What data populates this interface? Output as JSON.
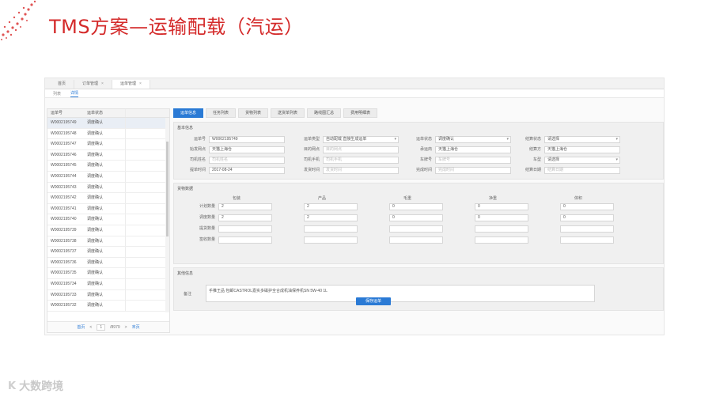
{
  "slide": {
    "title": "TMS方案—运输配载（汽运）",
    "brand_text": "大数跨境",
    "brand_logo": "K"
  },
  "colors": {
    "accent": "#2a7ad5",
    "title_red": "#d42a2a"
  },
  "topnav": {
    "tabs": [
      {
        "label": "首页",
        "closable": false
      },
      {
        "label": "订单管理",
        "closable": true
      },
      {
        "label": "运单管理",
        "closable": true
      }
    ],
    "close_glyph": "×"
  },
  "subtabs": {
    "list": "列表",
    "detail": "详情"
  },
  "left_table": {
    "headers": [
      "运单号",
      "运单状态"
    ],
    "rows": [
      {
        "id": "W0002195749",
        "status": "调度确认"
      },
      {
        "id": "W0002195748",
        "status": "调度确认"
      },
      {
        "id": "W0002195747",
        "status": "调度确认"
      },
      {
        "id": "W0002195746",
        "status": "调度确认"
      },
      {
        "id": "W0002195745",
        "status": "调度确认"
      },
      {
        "id": "W0002195744",
        "status": "调度确认"
      },
      {
        "id": "W0002195743",
        "status": "调度确认"
      },
      {
        "id": "W0002195742",
        "status": "调度确认"
      },
      {
        "id": "W0002195741",
        "status": "调度确认"
      },
      {
        "id": "W0002195740",
        "status": "调度确认"
      },
      {
        "id": "W0002195739",
        "status": "调度确认"
      },
      {
        "id": "W0002195738",
        "status": "调度确认"
      },
      {
        "id": "W0002195737",
        "status": "调度确认"
      },
      {
        "id": "W0002195736",
        "status": "调度确认"
      },
      {
        "id": "W0002195735",
        "status": "调度确认"
      },
      {
        "id": "W0002195734",
        "status": "调度确认"
      },
      {
        "id": "W0002195733",
        "status": "调度确认"
      },
      {
        "id": "W0002195732",
        "status": "调度确认"
      }
    ],
    "pager": {
      "first": "首页",
      "prev": "<",
      "page": "1",
      "total": "/8979",
      "next": ">",
      "last": "末页"
    }
  },
  "right_tabs": [
    "运单信息",
    "任务列表",
    "货物列表",
    "送货单列表",
    "路线图汇总",
    "费用明细表"
  ],
  "basic": {
    "title": "基本信息",
    "fields": [
      {
        "label": "运单号",
        "value": "W0002195749"
      },
      {
        "label": "运单类型",
        "value": "自动配载 直接生成运单"
      },
      {
        "label": "运单状态",
        "value": "调度确认"
      },
      {
        "label": "结算状态",
        "value": "请选择"
      },
      {
        "label": "始发网点",
        "value": "天猫上海仓"
      },
      {
        "label": "目的网点",
        "value": "目的网点"
      },
      {
        "label": "承运商",
        "value": "天猫上海仓"
      },
      {
        "label": "结算方",
        "value": "天猫上海仓"
      },
      {
        "label": "司机姓名",
        "value": "司机姓名"
      },
      {
        "label": "司机手机",
        "value": "司机手机"
      },
      {
        "label": "车牌号",
        "value": "车牌号"
      },
      {
        "label": "车型",
        "value": "请选择"
      },
      {
        "label": "提单时间",
        "value": "2017-08-24"
      },
      {
        "label": "发货时间",
        "value": "发货时间"
      },
      {
        "label": "完成时间",
        "value": "完成时间"
      },
      {
        "label": "结算日期",
        "value": "结算日期"
      }
    ]
  },
  "goods": {
    "title": "货物数据",
    "columns": [
      "包装",
      "产品",
      "毛重",
      "净重",
      "体积"
    ],
    "rows": [
      {
        "label": "计划数量",
        "values": [
          "2",
          "2",
          "0",
          "0",
          "0"
        ]
      },
      {
        "label": "调度数量",
        "values": [
          "2",
          "2",
          "0",
          "0",
          "0"
        ]
      },
      {
        "label": "提货数量",
        "values": [
          "",
          "",
          "",
          "",
          ""
        ]
      },
      {
        "label": "签收数量",
        "values": [
          "",
          "",
          "",
          "",
          ""
        ]
      }
    ]
  },
  "other": {
    "title": "其他信息",
    "remark_label": "备注",
    "remark_value": "手推王品 包邮CASTROL嘉实多磁护全合成机油保养机SN 5W-40 1L"
  },
  "save_button": "保存运单"
}
